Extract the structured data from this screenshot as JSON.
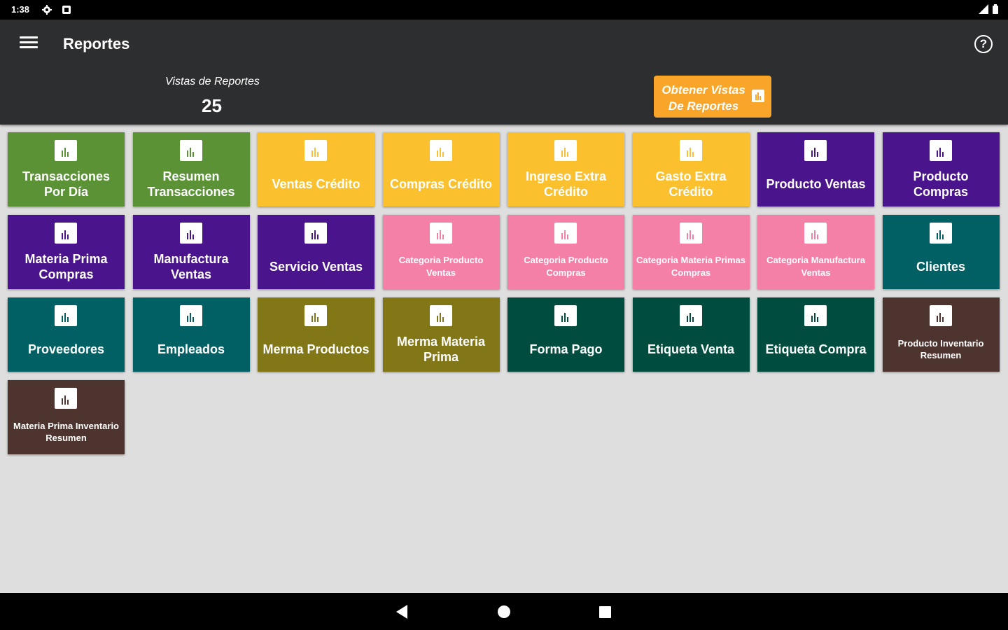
{
  "status_bar": {
    "time": "1:38",
    "icons": [
      "settings-icon",
      "notification-icon",
      "signal-icon",
      "battery-icon"
    ]
  },
  "app_bar": {
    "title": "Reportes",
    "menu_icon": "menu-icon",
    "help_icon": "help-icon",
    "help_glyph": "?"
  },
  "summary": {
    "label": "Vistas de Reportes",
    "count": "25",
    "get_views_button": {
      "line1": "Obtener Vistas",
      "line2": "De Reportes",
      "icon": "bar-chart-icon"
    }
  },
  "colors": {
    "green": "#5a9235",
    "yellow": "#fbc02d",
    "purple": "#4a148c",
    "pink": "#f480a8",
    "teal": "#006064",
    "olive": "#827717",
    "dark_green": "#004d40",
    "brown": "#4e342e",
    "accent_orange": "#f9a52a"
  },
  "tiles": [
    {
      "label": "Transacciones Por Día",
      "color": "#5a9235",
      "size": "normal"
    },
    {
      "label": "Resumen Transacciones",
      "color": "#5a9235",
      "size": "normal"
    },
    {
      "label": "Ventas Crédito",
      "color": "#fbc02d",
      "size": "normal"
    },
    {
      "label": "Compras Crédito",
      "color": "#fbc02d",
      "size": "normal"
    },
    {
      "label": "Ingreso Extra Crédito",
      "color": "#fbc02d",
      "size": "normal"
    },
    {
      "label": "Gasto Extra Crédito",
      "color": "#fbc02d",
      "size": "normal"
    },
    {
      "label": "Producto Ventas",
      "color": "#4a148c",
      "size": "normal"
    },
    {
      "label": "Producto Compras",
      "color": "#4a148c",
      "size": "normal"
    },
    {
      "label": "Materia Prima Compras",
      "color": "#4a148c",
      "size": "normal"
    },
    {
      "label": "Manufactura Ventas",
      "color": "#4a148c",
      "size": "normal"
    },
    {
      "label": "Servicio Ventas",
      "color": "#4a148c",
      "size": "normal"
    },
    {
      "label": "Categoria Producto Ventas",
      "color": "#f480a8",
      "size": "small"
    },
    {
      "label": "Categoria Producto Compras",
      "color": "#f480a8",
      "size": "small"
    },
    {
      "label": "Categoria Materia Primas Compras",
      "color": "#f480a8",
      "size": "small"
    },
    {
      "label": "Categoria Manufactura Ventas",
      "color": "#f480a8",
      "size": "small"
    },
    {
      "label": "Clientes",
      "color": "#006064",
      "size": "normal"
    },
    {
      "label": "Proveedores",
      "color": "#006064",
      "size": "normal"
    },
    {
      "label": "Empleados",
      "color": "#006064",
      "size": "normal"
    },
    {
      "label": "Merma Productos",
      "color": "#827717",
      "size": "normal"
    },
    {
      "label": "Merma Materia Prima",
      "color": "#827717",
      "size": "normal"
    },
    {
      "label": "Forma Pago",
      "color": "#004d40",
      "size": "normal"
    },
    {
      "label": "Etiqueta Venta",
      "color": "#004d40",
      "size": "normal"
    },
    {
      "label": "Etiqueta Compra",
      "color": "#004d40",
      "size": "normal"
    },
    {
      "label": "Producto Inventario Resumen",
      "color": "#4e342e",
      "size": "tiny"
    },
    {
      "label": "Materia Prima Inventario Resumen",
      "color": "#4e342e",
      "size": "tiny"
    }
  ],
  "nav_bar": {
    "icons": [
      "back-icon",
      "home-icon",
      "recents-icon"
    ]
  }
}
